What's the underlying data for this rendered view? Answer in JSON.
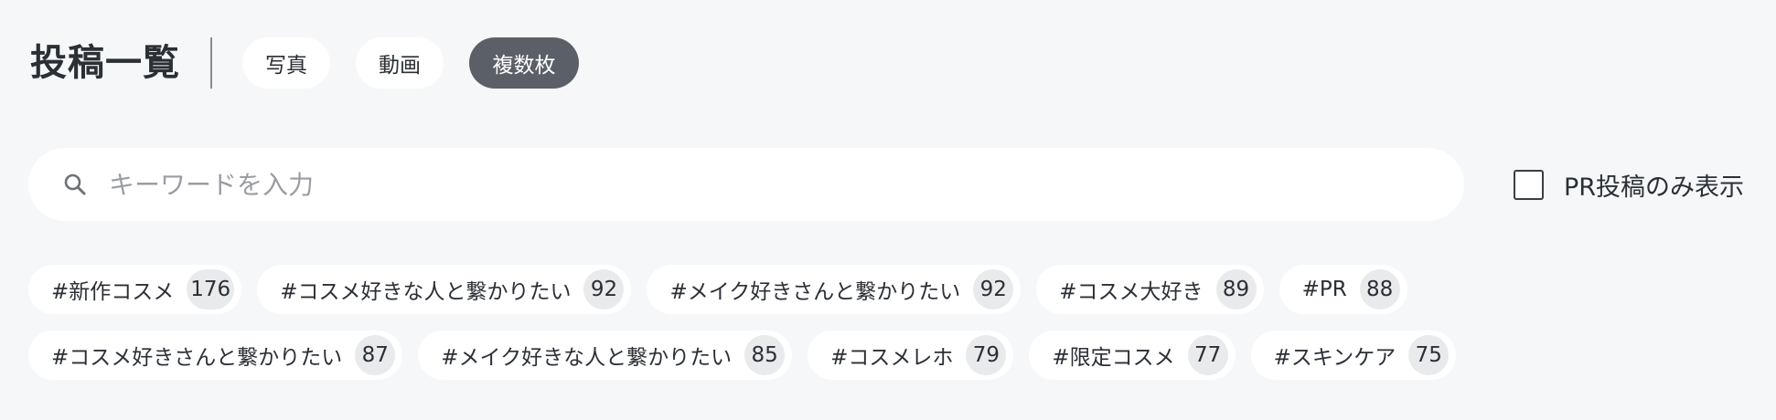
{
  "header": {
    "title": "投稿一覧",
    "tabs": [
      {
        "label": "写真",
        "active": false
      },
      {
        "label": "動画",
        "active": false
      },
      {
        "label": "複数枚",
        "active": true
      }
    ]
  },
  "search": {
    "value": "",
    "placeholder": "キーワードを入力",
    "icon": "search-icon"
  },
  "pr_filter": {
    "label": "PR投稿のみ表示",
    "checked": false
  },
  "tags": {
    "row1": [
      {
        "label": "#新作コスメ",
        "count": "176"
      },
      {
        "label": "#コスメ好きな人と繋かりたい",
        "count": "92"
      },
      {
        "label": "#メイク好きさんと繋かりたい",
        "count": "92"
      },
      {
        "label": "#コスメ大好き",
        "count": "89"
      },
      {
        "label": "#PR",
        "count": "88"
      }
    ],
    "row2": [
      {
        "label": "#コスメ好きさんと繋かりたい",
        "count": "87"
      },
      {
        "label": "#メイク好きな人と繋かりたい",
        "count": "85"
      },
      {
        "label": "#コスメレホ",
        "count": "79"
      },
      {
        "label": "#限定コスメ",
        "count": "77"
      },
      {
        "label": "#スキンケア",
        "count": "75"
      }
    ]
  },
  "colors": {
    "background": "#f6f7f9",
    "active_tab": "#5b5f67",
    "count_badge": "#e9eaec",
    "text": "#2b2f36",
    "placeholder": "#9a9da3"
  }
}
